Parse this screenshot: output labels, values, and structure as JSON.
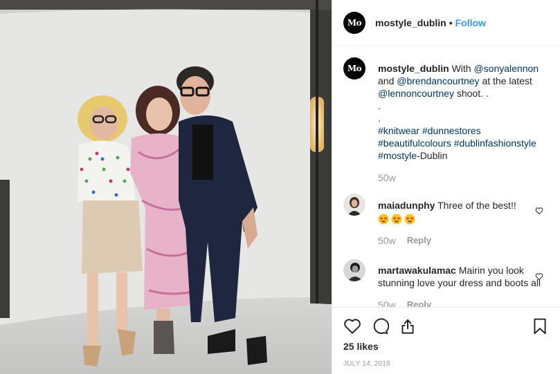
{
  "header": {
    "avatar_text": "Mo",
    "username": "mostyle_dublin",
    "separator": "•",
    "follow_label": "Follow"
  },
  "caption": {
    "username": "mostyle_dublin",
    "text_1": "With",
    "mention_1": "@sonyalennon",
    "text_2": "and",
    "mention_2": "@brendancourtney",
    "text_3": "at the latest",
    "mention_3": "@lennoncourtney",
    "text_4": "shoot. .",
    "dot_line_1": ".",
    "dot_line_2": ".",
    "hashtag_1": "#knitwear",
    "hashtag_2": "#dunnestores",
    "hashtag_3": "#beautifulcolours",
    "hashtag_4": "#dublinfashionstyle",
    "hashtag_5": "#mostyle",
    "suffix": "-Dublin",
    "time": "50w"
  },
  "comments": [
    {
      "username": "maiadunphy",
      "text": "Three of the best!!",
      "emoji": "star-struck",
      "time": "50w",
      "reply_label": "Reply"
    },
    {
      "username": "martawakulamac",
      "text": "Mairin you look stunning love your dress and boots all",
      "time": "50w",
      "reply_label": "Reply"
    }
  ],
  "actions": {
    "likes": "25 likes",
    "date": "JULY 14, 2018"
  },
  "colors": {
    "link": "#003569",
    "follow": "#3897f0",
    "muted": "#999999",
    "text": "#262626"
  }
}
